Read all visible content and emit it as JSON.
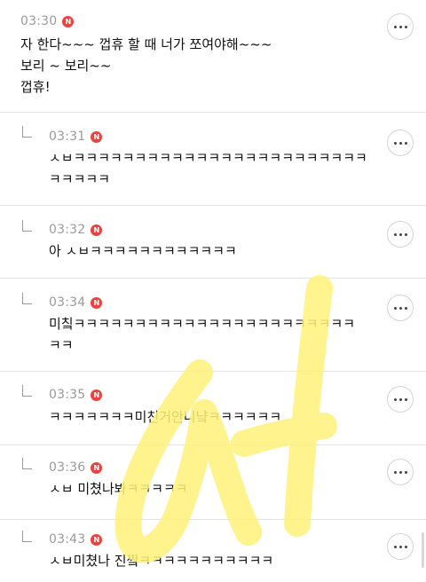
{
  "badge_letter": "N",
  "accent_color": "#e8433f",
  "watermark_color": "#fff27a",
  "comments": [
    {
      "time": "03:30",
      "lines": [
        "자 한다~~~ 껍휴 할 때 너가 쪼여야해~~~",
        "보리 ~ 보리~~",
        "껍휴!"
      ]
    },
    {
      "time": "03:31",
      "lines": [
        "ㅅㅂㅋㅋㅋㅋㅋㅋㅋㅋㅋㅋㅋㅋㅋㅋㅋㅋㅋㅋㅋㅋㅋㅋㅋㅋ",
        "ㅋㅋㅋㅋㅋ"
      ]
    },
    {
      "time": "03:32",
      "lines": [
        "아 ㅅㅂㅋㅋㅋㅋㅋㅋㅋㅋㅋㅋㅋㅋ"
      ]
    },
    {
      "time": "03:34",
      "lines": [
        "미칰ㅋㅋㅋㅋㅋㅋㅋㅋㅋㅋㅋㅋㅋㅋㅋㅋㅋㅋㅋㅋㅋㅋㅋ",
        "ㅋㅋ"
      ]
    },
    {
      "time": "03:35",
      "lines": [
        "ㅋㅋㅋㅋㅋㅋㅋ미친거안니냨ㅋㅋㅋㅋㅋㅋ"
      ]
    },
    {
      "time": "03:36",
      "lines": [
        "ㅅㅂ 미쳤나봐ㅋㅋㅋㅋㅋ"
      ]
    },
    {
      "time": "03:43",
      "lines": [
        "ㅅㅂ미쳤나 진짴ㅋㅋㅋㅋㅋㅋㅋㅋㅋㅋㅋ"
      ]
    }
  ]
}
